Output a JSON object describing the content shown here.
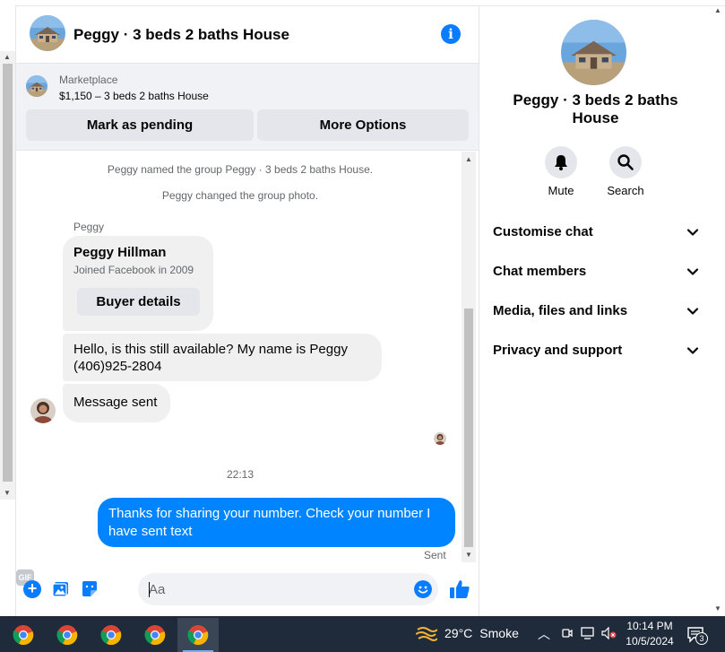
{
  "chat": {
    "title": "Peggy · 3 beds 2 baths House",
    "marketplace": {
      "label": "Marketplace",
      "listing": "$1,150 – 3 beds 2 baths House",
      "mark_pending": "Mark as pending",
      "more_options": "More Options"
    },
    "system_messages": [
      "Peggy named the group Peggy · 3 beds 2 baths House.",
      "Peggy changed the group photo."
    ],
    "sender_name": "Peggy",
    "profile_card": {
      "name": "Peggy Hillman",
      "joined": "Joined Facebook in 2009",
      "button": "Buyer details"
    },
    "messages": [
      {
        "text": "Hello, is this still available? My name is Peggy (406)925-2804",
        "direction": "incoming"
      },
      {
        "text": "Message sent",
        "direction": "incoming"
      }
    ],
    "timestamp": "22:13",
    "outgoing": {
      "text": "Thanks for sharing your number.  Check your number I have sent text",
      "status": "Sent"
    },
    "composer": {
      "placeholder": "Aa",
      "gif_label": "GIF"
    }
  },
  "panel": {
    "title": "Peggy · 3 beds 2 baths House",
    "actions": [
      {
        "label": "Mute",
        "icon": "bell-icon"
      },
      {
        "label": "Search",
        "icon": "search-icon"
      }
    ],
    "menu": [
      "Customise chat",
      "Chat members",
      "Media, files and links",
      "Privacy and support"
    ]
  },
  "taskbar": {
    "weather_temp": "29°C",
    "weather_desc": "Smoke",
    "time": "10:14 PM",
    "date": "10/5/2024",
    "notification_count": "3"
  },
  "colors": {
    "messenger_blue": "#0084ff",
    "icon_blue": "#0a7cff",
    "bubble_gray": "#f0f0f0",
    "taskbar": "#1f2b3a"
  }
}
